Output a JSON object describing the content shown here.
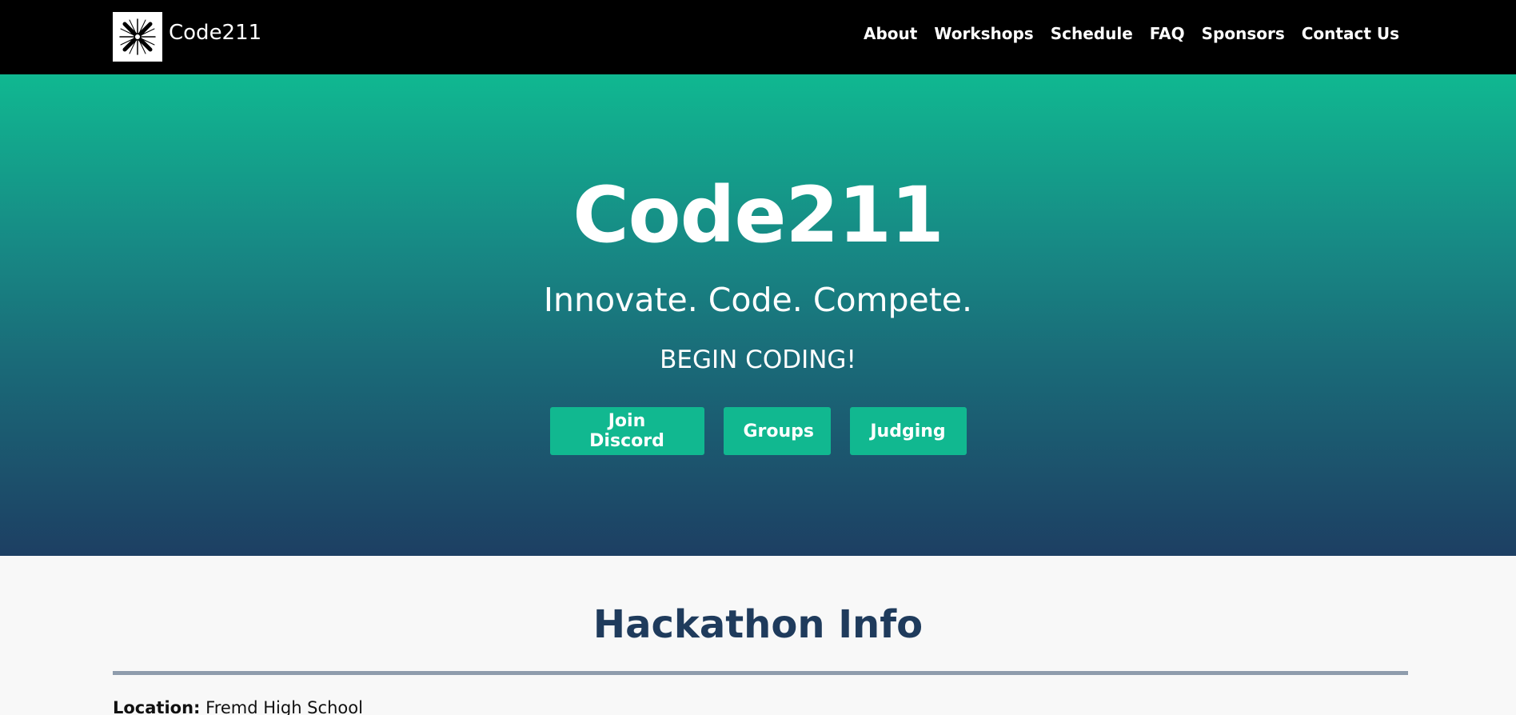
{
  "nav": {
    "brand": "Code211",
    "links": [
      "About",
      "Workshops",
      "Schedule",
      "FAQ",
      "Sponsors",
      "Contact Us"
    ]
  },
  "hero": {
    "title": "Code211",
    "tagline": "Innovate. Code. Compete.",
    "cta": "BEGIN CODING!",
    "buttons": [
      "Join Discord",
      "Groups",
      "Judging"
    ]
  },
  "info": {
    "title": "Hackathon Info",
    "location_label": "Location:",
    "location_value": "Fremd High School"
  },
  "colors": {
    "accent": "#11b890",
    "navy": "#1f3b5c",
    "nav_bg": "#000000"
  },
  "icons": {
    "logo": "code211-logo"
  }
}
